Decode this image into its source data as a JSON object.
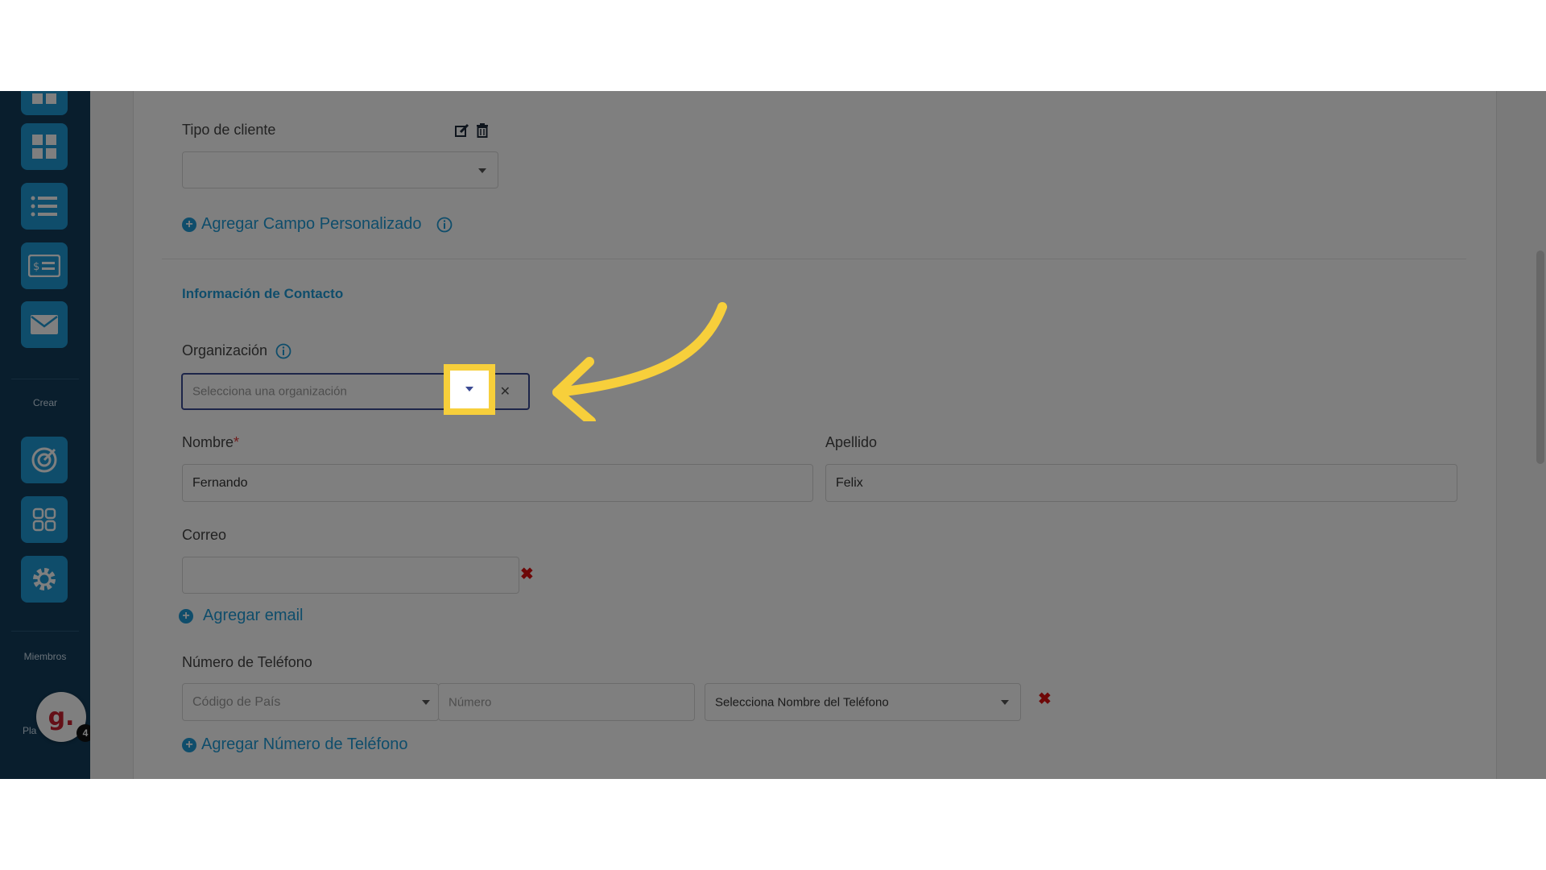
{
  "sidebar": {
    "crear_label": "Crear",
    "miembros_label": "Miembros",
    "planes_label": "Pla",
    "avatar_letter": "g.",
    "notification_count": "4",
    "icons": [
      "grid-icon",
      "list-icon",
      "invoice-icon",
      "mail-icon",
      "target-icon",
      "apps-icon",
      "gear-icon"
    ]
  },
  "form": {
    "tipo_cliente": {
      "label": "Tipo de cliente",
      "value": ""
    },
    "add_custom_field": "Agregar Campo Personalizado",
    "contact_section_title": "Información de Contacto",
    "organizacion": {
      "label": "Organización",
      "placeholder": "Selecciona una organización"
    },
    "nombre": {
      "label": "Nombre",
      "required_mark": "*",
      "value": "Fernando"
    },
    "apellido": {
      "label": "Apellido",
      "value": "Felix"
    },
    "correo": {
      "label": "Correo",
      "value": ""
    },
    "add_email": "Agregar email",
    "telefono": {
      "label": "Número de Teléfono",
      "country_placeholder": "Código de País",
      "number_placeholder": "Número",
      "name_select": "Selecciona Nombre del Teléfono"
    },
    "add_phone": "Agregar Número de Teléfono"
  },
  "colors": {
    "accent": "#1e9bd7",
    "highlight": "#f7cf3b",
    "sidebar_bg": "#123c5a",
    "delete": "#dd1111"
  }
}
